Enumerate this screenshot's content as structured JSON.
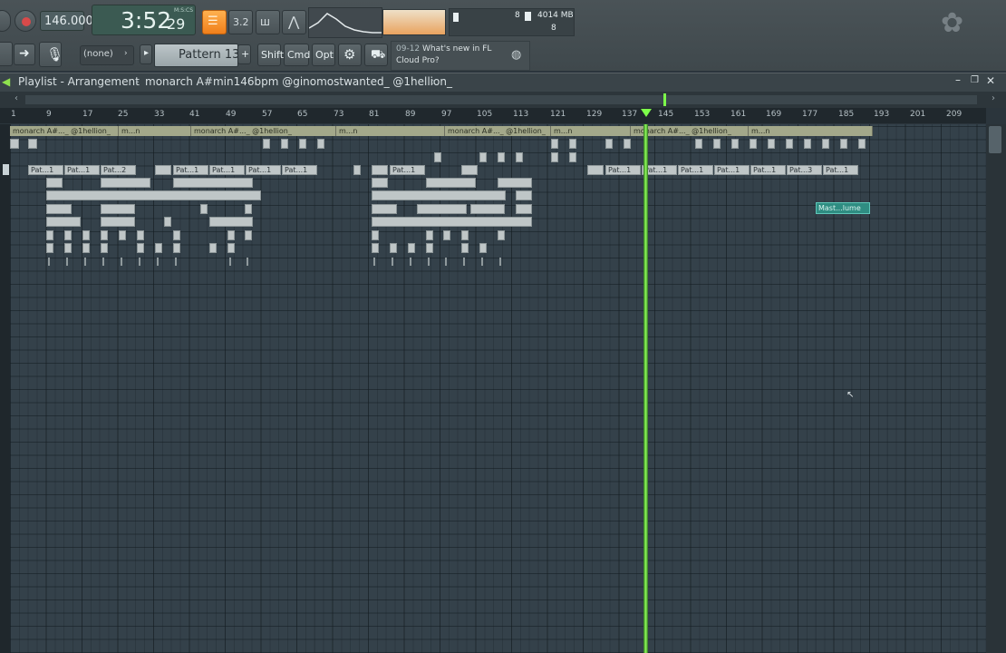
{
  "toolbar": {
    "tempo": "146.000",
    "time_main": "3:52",
    "time_sub": "29",
    "time_label": "M:S:CS",
    "snap": "(none)",
    "pattern": "Pattern 13",
    "shift": "Shift",
    "cmd": "Cmd",
    "opt": "Opt",
    "cpu": "8",
    "memory": "4014 MB",
    "voices": "8",
    "news_date": "09-12",
    "news_line1": "What's new in FL",
    "news_line2": "Cloud Pro?",
    "mode_label": "3.2",
    "colors": {
      "accent": "#ff9b2e",
      "lcd": "#3b5a52"
    }
  },
  "playlist": {
    "title": "Playlist - Arrangement",
    "separator": "›",
    "project": "monarch A#min146bpm @ginomostwanted_ @1hellion_",
    "ruler": [
      "1",
      "9",
      "17",
      "25",
      "33",
      "41",
      "49",
      "57",
      "65",
      "73",
      "81",
      "89",
      "97",
      "105",
      "113",
      "121",
      "129",
      "137",
      "145",
      "153",
      "161",
      "169",
      "177",
      "185",
      "193",
      "201",
      "209"
    ],
    "audio_labels": [
      "monarch A#..._ @1hellion_",
      "m...n",
      "monarch A#..._ @1hellion_",
      "m...n",
      "monarch A#..._ @1hellion_",
      "m...n",
      "monarch A#..._ @1hellion_",
      "m...n"
    ],
    "pattern_labels": [
      "Pat...1",
      "Pat...1",
      "Pat...2",
      "Pat...1",
      "Pat...1",
      "Pat...1",
      "Pat...1",
      "Pat...1",
      "Pat...1",
      "Pat...1",
      "Pat...1",
      "Pat...1",
      "Pat...1",
      "Pat...3",
      "Pat...1"
    ],
    "automation_label": "Mast...lume",
    "colors": {
      "playhead": "#7dff4a",
      "automation": "#2f8d82"
    }
  }
}
